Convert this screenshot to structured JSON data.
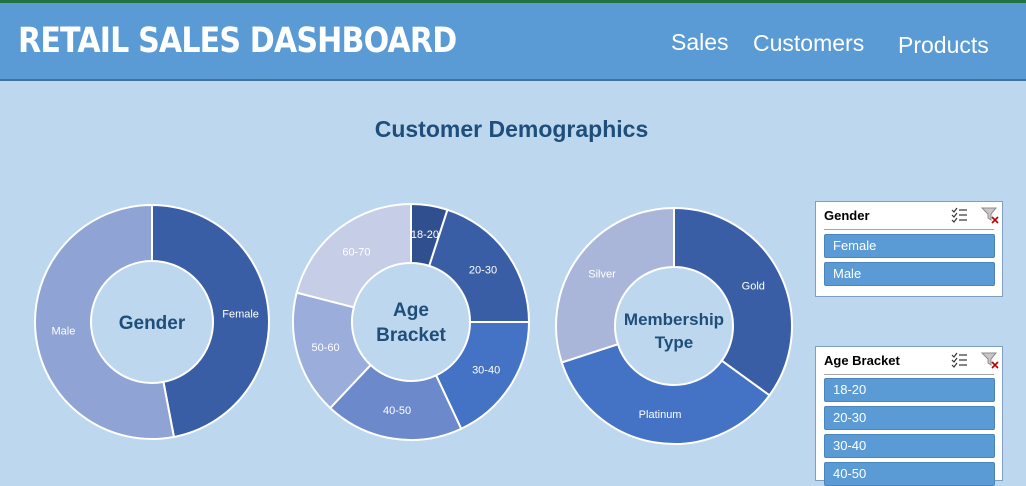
{
  "header": {
    "title": "RETAIL SALES DASHBOARD",
    "nav": [
      "Sales",
      "Customers",
      "Products"
    ]
  },
  "section_title": "Customer Demographics",
  "colors": {
    "header_bg": "#5b9bd5",
    "page_bg": "#bdd7ee",
    "title_text": "#1f4e79",
    "slicer_item": "#5b9bd5"
  },
  "chart_data": [
    {
      "type": "pie",
      "center_label": "Gender",
      "categories": [
        "Female",
        "Male"
      ],
      "values": [
        47,
        53
      ],
      "colors": [
        "#3a5ea5",
        "#8fa4d4"
      ]
    },
    {
      "type": "pie",
      "center_label": "Age Bracket",
      "categories": [
        "18-20",
        "20-30",
        "30-40",
        "40-50",
        "50-60",
        "60-70"
      ],
      "values": [
        5,
        20,
        18,
        19,
        17,
        21
      ],
      "colors": [
        "#2f4f8e",
        "#3a5ea5",
        "#4472c4",
        "#6c89cb",
        "#9aaddb",
        "#c6cde6"
      ]
    },
    {
      "type": "pie",
      "center_label": "Membership Type",
      "categories": [
        "Gold",
        "Platinum",
        "Silver"
      ],
      "values": [
        35,
        35,
        30
      ],
      "colors": [
        "#3a5ea5",
        "#4472c4",
        "#a9b6da"
      ]
    }
  ],
  "slicers": [
    {
      "title": "Gender",
      "items": [
        "Female",
        "Male"
      ]
    },
    {
      "title": "Age Bracket",
      "items": [
        "18-20",
        "20-30",
        "30-40",
        "40-50"
      ]
    }
  ],
  "icons": [
    "multi-select-icon",
    "clear-filter-icon"
  ]
}
